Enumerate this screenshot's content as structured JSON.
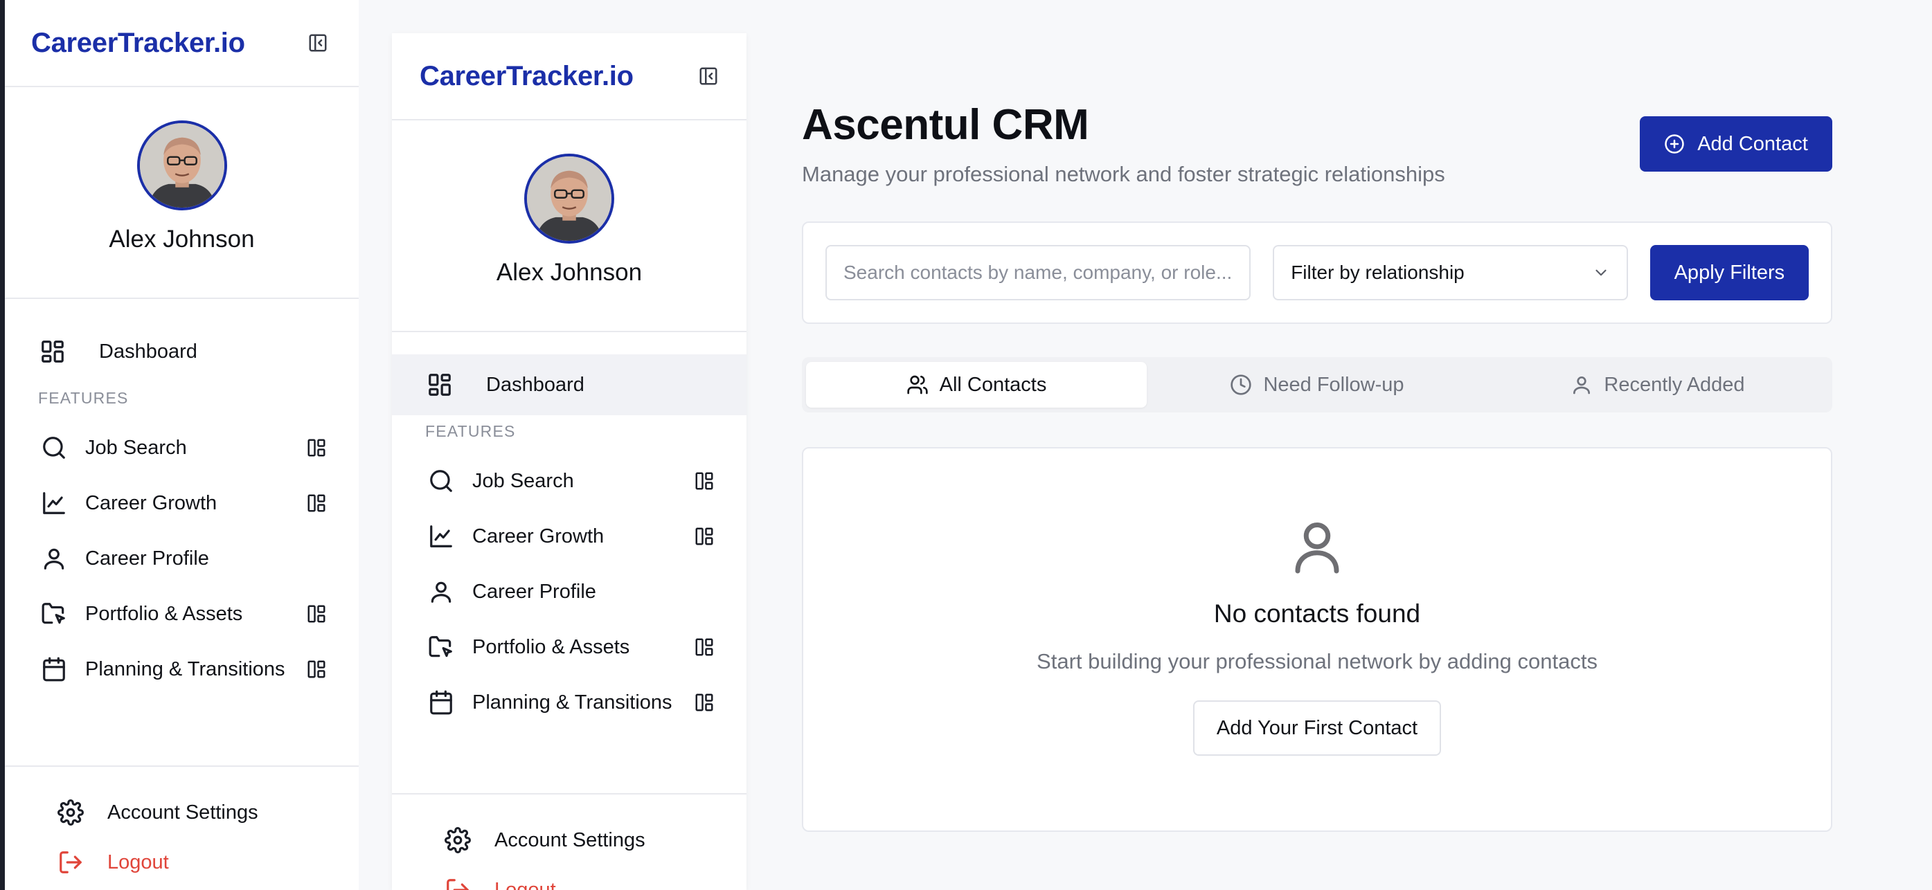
{
  "brand": "CareerTracker.io",
  "user": {
    "name": "Alex Johnson"
  },
  "nav": {
    "dashboard": "Dashboard",
    "features_label": "FEATURES"
  },
  "features": [
    {
      "label": "Job Search",
      "icon": "search-icon"
    },
    {
      "label": "Career Growth",
      "icon": "line-chart-icon"
    },
    {
      "label": "Career Profile",
      "icon": "user-icon"
    },
    {
      "label": "Portfolio & Assets",
      "icon": "folder-icon"
    },
    {
      "label": "Planning & Transitions",
      "icon": "calendar-icon"
    }
  ],
  "footer": {
    "settings": "Account Settings",
    "logout": "Logout"
  },
  "page": {
    "title": "Ascentul CRM",
    "subtitle": "Manage your professional network and foster strategic relationships",
    "add_contact": "Add Contact"
  },
  "filters": {
    "search_placeholder": "Search contacts by name, company, or role...",
    "relationship": "Filter by relationship",
    "apply": "Apply Filters"
  },
  "tabs": [
    "All Contacts",
    "Need Follow-up",
    "Recently Added"
  ],
  "empty": {
    "title": "No contacts found",
    "subtitle": "Start building your professional network by adding contacts",
    "button": "Add Your First Contact"
  },
  "colors": {
    "accent": "#1b2fa8",
    "danger": "#e0453a",
    "page_bg": "#f7f8fa"
  }
}
